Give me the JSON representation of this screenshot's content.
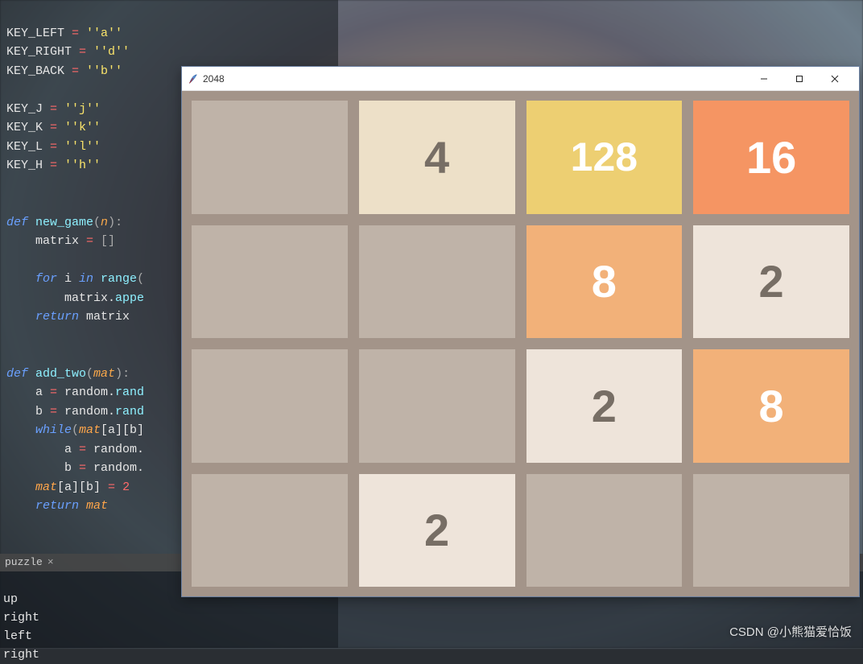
{
  "editor": {
    "l01a": "KEY_LEFT ",
    "l01b": "= ",
    "l01c": "''a''",
    "l02a": "KEY_RIGHT ",
    "l02b": "= ",
    "l02c": "''d''",
    "l03a": "KEY_BACK ",
    "l03b": "= ",
    "l03c": "''b''",
    "l05a": "KEY_J ",
    "l05b": "= ",
    "l05c": "''j''",
    "l06a": "KEY_K ",
    "l06b": "= ",
    "l06c": "''k''",
    "l07a": "KEY_L ",
    "l07b": "= ",
    "l07c": "''l''",
    "l08a": "KEY_H ",
    "l08b": "= ",
    "l08c": "''h''",
    "def1": "def ",
    "fn1": "new_game",
    "paren1": "(",
    "p1": "n",
    "paren1b": "):",
    "l11a": "    matrix ",
    "l11b": "= ",
    "l11c": "[]",
    "for1": "    for ",
    "for1v": "i ",
    "in1": "in ",
    "rng1": "range",
    "rng1p": "(",
    "l14a": "        matrix.",
    "l14b": "appe",
    "ret1": "    return ",
    "ret1v": "matrix",
    "def2": "def ",
    "fn2": "add_two",
    "paren2": "(",
    "p2": "mat",
    "paren2b": "):",
    "l19a": "    a ",
    "l19b": "= ",
    "l19c": "random.",
    "l19d": "rand",
    "l20a": "    b ",
    "l20b": "= ",
    "l20c": "random.",
    "l20d": "rand",
    "wh1": "    while",
    "wh1p": "(",
    "wh1m": "mat",
    "wh1b": "[a][b]",
    "l22a": "        a ",
    "l22b": "= ",
    "l22c": "random.",
    "l23a": "        b ",
    "l23b": "= ",
    "l23c": "random.",
    "l24a": "    ",
    "l24m": "mat",
    "l24b": "[a][b] ",
    "l24c": "= ",
    "l24d": "2",
    "ret2": "    return ",
    "ret2v": "mat"
  },
  "terminal": {
    "tab": "puzzle",
    "tabClose": "×",
    "out1": "up",
    "out2": "right",
    "out3": "left",
    "out4": "right"
  },
  "game": {
    "title": "2048",
    "board": [
      [
        0,
        4,
        128,
        16
      ],
      [
        0,
        0,
        8,
        2
      ],
      [
        0,
        0,
        2,
        8
      ],
      [
        0,
        2,
        0,
        0
      ]
    ],
    "tileClassMap": {
      "0": "empty",
      "2": "v2",
      "4": "v4",
      "8": "v8",
      "16": "v16",
      "128": "v128"
    }
  },
  "watermark": "CSDN @小熊猫爱恰饭"
}
